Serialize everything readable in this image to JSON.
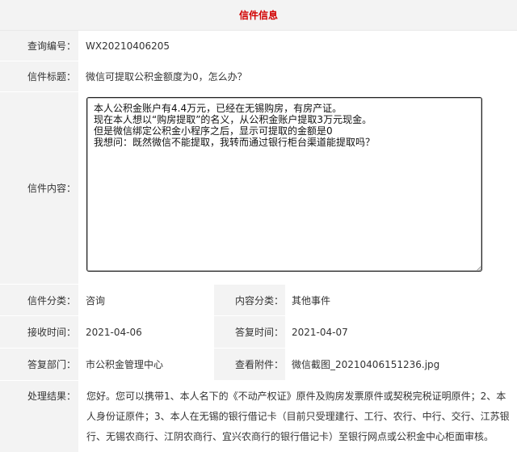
{
  "header": {
    "title": "信件信息"
  },
  "query_no": {
    "label": "查询编号：",
    "value": "WX20210406205"
  },
  "subject": {
    "label": "信件标题：",
    "value": "微信可提取公积金额度为0，怎么办？"
  },
  "content": {
    "label": "信件内容：",
    "value": "本人公积金账户有4.4万元，已经在无锡购房，有房产证。\n现在本人想以“购房提取”的名义，从公积金账户提取3万元现金。\n但是微信绑定公积金小程序之后，显示可提取的金额是0\n我想问：既然微信不能提取，我转而通过银行柜台渠道能提取吗？"
  },
  "category": {
    "label": "信件分类：",
    "value": "咨询"
  },
  "content_category": {
    "label": "内容分类：",
    "value": "其他事件"
  },
  "received": {
    "label": "接收时间：",
    "value": "2021-04-06"
  },
  "replied": {
    "label": "答复时间：",
    "value": "2021-04-07"
  },
  "department": {
    "label": "答复部门：",
    "value": "市公积金管理中心"
  },
  "attachment": {
    "label": "查看附件：",
    "value": "微信截图_20210406151236.jpg"
  },
  "result": {
    "label": "处理结果：",
    "value": "您好。您可以携带1、本人名下的《不动产权证》原件及购房发票原件或契税完税证明原件；2、本人身份证原件；3、本人在无锡的银行借记卡（目前只受理建行、工行、农行、中行、交行、江苏银行、无锡农商行、江阴农商行、宜兴农商行的银行借记卡）至银行网点或公积金中心柜面审核。"
  },
  "colors": {
    "title": "#d20000",
    "label_bg": "#f3f3f3"
  }
}
